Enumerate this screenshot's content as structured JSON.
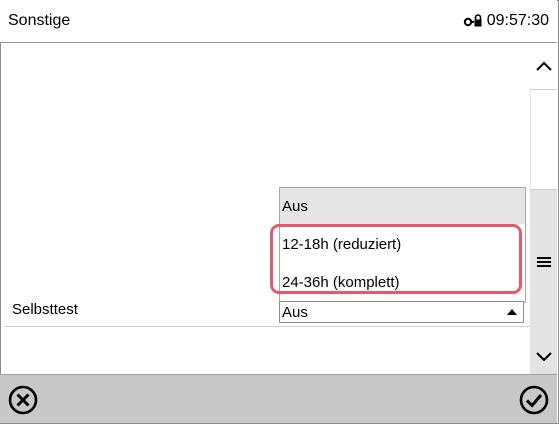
{
  "header": {
    "title": "Sonstige",
    "time": "09:57:30",
    "status_icon": "key-lock-icon"
  },
  "scrollbar": {
    "up_icon": "chevron-up-icon",
    "menu_icon": "hamburger-menu-icon",
    "down_icon": "chevron-down-icon"
  },
  "setting": {
    "label": "Selbsttest",
    "value": "Aus",
    "options": [
      "Aus",
      "12-18h (reduziert)",
      "24-36h (komplett)"
    ],
    "selected_index": 0,
    "highlighted_options": [
      "12-18h (reduziert)",
      "24-36h (komplett)"
    ],
    "highlight_color": "#e05c6c"
  },
  "footer": {
    "cancel_icon": "cancel-circle-x-icon",
    "confirm_icon": "confirm-circle-check-icon"
  }
}
